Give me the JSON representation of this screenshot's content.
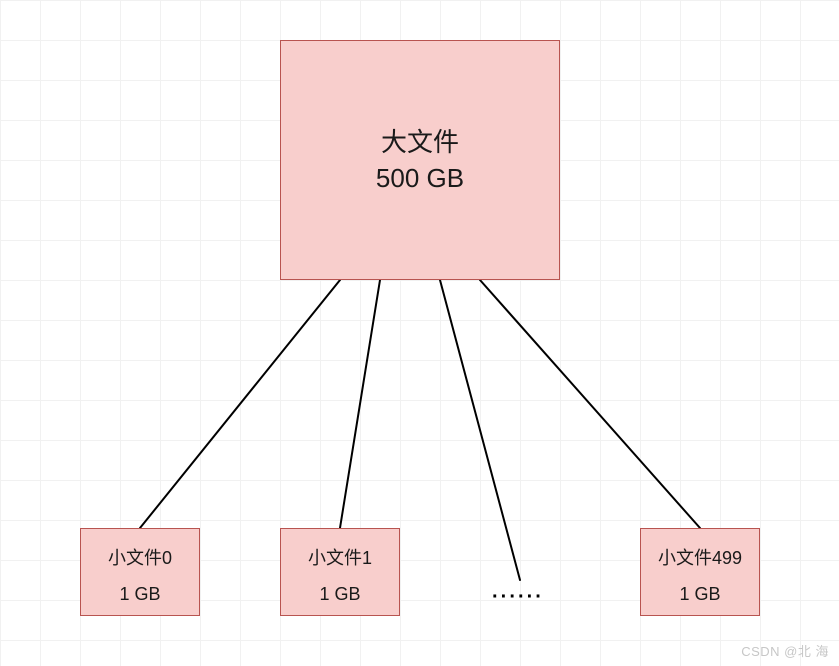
{
  "large_file": {
    "title": "大文件",
    "size": "500 GB"
  },
  "small_files": [
    {
      "name": "小文件0",
      "size": "1 GB"
    },
    {
      "name": "小文件1",
      "size": "1 GB"
    },
    {
      "name": "小文件499",
      "size": "1 GB"
    }
  ],
  "ellipsis": "······",
  "watermark": "CSDN @北   海"
}
